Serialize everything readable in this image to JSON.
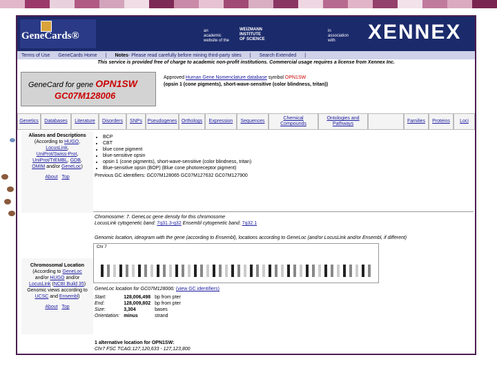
{
  "stripe_colors": [
    "#e2b7c9",
    "#9b3a6a",
    "#e8d1dc",
    "#b05a84",
    "#d3a4bb",
    "#f0dde6",
    "#7e2a56",
    "#c98aa8",
    "#e6c3d3",
    "#a24a76",
    "#d9adc2",
    "#8a3663",
    "#efd7e2",
    "#b76a90",
    "#e1b4c8",
    "#93406b",
    "#f2e2ea",
    "#c07a9c",
    "#dba9c0",
    "#7a2550"
  ],
  "header": {
    "logo_text": "GeneCards",
    "logo_mark": "®",
    "text_left": "an\nacademic\nwebsite of the",
    "text_inst": "WEIZMANN\nINSTITUTE\nOF SCIENCE",
    "text_right": "in\nassociation\nwith",
    "xennex": "XENNEX"
  },
  "navbar": {
    "items": [
      "Terms of Use",
      "GeneCards Home",
      "|",
      "Notes",
      "- Please read carefully before mining third-party sites",
      "|",
      "Search Extended",
      "|"
    ],
    "notes_label": "Notes"
  },
  "notice": "This service is provided free of charge to academic non-profit institutions. Commercial usage requires a license from Xennex Inc.",
  "title": {
    "prefix": "GeneCard for gene ",
    "gene": "OPN1SW",
    "gc_id": "GC07M128006"
  },
  "approved": {
    "pre": "Approved ",
    "link": "Human Gene Nomenclature database",
    "mid": " symbol ",
    "symbol": "OPN1SW",
    "desc": "(opsin 1 (cone pigments), short-wave-sensitive (color blindness, tritan))"
  },
  "tabs": [
    "Genetics",
    "Databases",
    "Literature",
    "Disorders",
    "SNPs",
    "Pseudogenes",
    "Orthologs",
    "Expression",
    "Sequences",
    "Chemical Compounds",
    "Ontologies and Pathways",
    "",
    "Families",
    "Proteins",
    "Loci"
  ],
  "aliases": {
    "heading": "Aliases and Descriptions",
    "according": "(According to",
    "sources": [
      "HUGO",
      "LocusLink",
      "UniProt/Swiss-Prot",
      "UniProt/TrEMBL",
      "GDB",
      "OMIM",
      "GeneLoc"
    ],
    "about": "About",
    "top": "Top",
    "items": [
      "BCP",
      "CBT",
      "blue cone pigment",
      "blue-sensitive opsin",
      "opsin 1 (cone pigments), short-wave-sensitive (color blindness, tritan)",
      "Blue-sensitive opsin (BOP) (Blue cone photoreceptor pigment)"
    ],
    "previous": "Previous GC identifiers: GC07M128065 GC07M127632 GC07M127900"
  },
  "chromosome": {
    "heading": "Chromosomal Location",
    "according": "(According to",
    "sources": [
      "GeneLoc",
      "HUGO",
      "LocusLink",
      "NCBI Build 35",
      "UCSC",
      "Ensembl"
    ],
    "about": "About",
    "top": "Top",
    "line1": "Chromosome: 7. GeneLoc gene density for this chromosome",
    "line2_pre": "LocusLink cytogenetic band: ",
    "band1": "7q31.3-q32",
    "line2_mid": "   Ensembl cytogenetic band: ",
    "band2": "7q32.1",
    "line3": "Genomic location, ideogram with the gene (according to Ensembl), locations according to GeneLoc (and/or LocusLink and/or Ensembl, if different)",
    "ideo_label": "Chr 7",
    "gl_title": "GeneLoc location for GC07M128006:",
    "gl_link": "(view GC identifiers)",
    "rows": [
      {
        "k": "Start:",
        "v": "128,006,498",
        "u": "bp from pter"
      },
      {
        "k": "End:",
        "v": "128,009,802",
        "u": "bp from pter"
      },
      {
        "k": "Size:",
        "v": "3,304",
        "u": "bases"
      },
      {
        "k": "Orientation:",
        "v": "minus",
        "u": "strand"
      }
    ],
    "alt": "1 alternative location for OPN1SW:",
    "alt_row": "Chr7  FSC  TCAG:127,120,633 - 127,123,800"
  }
}
